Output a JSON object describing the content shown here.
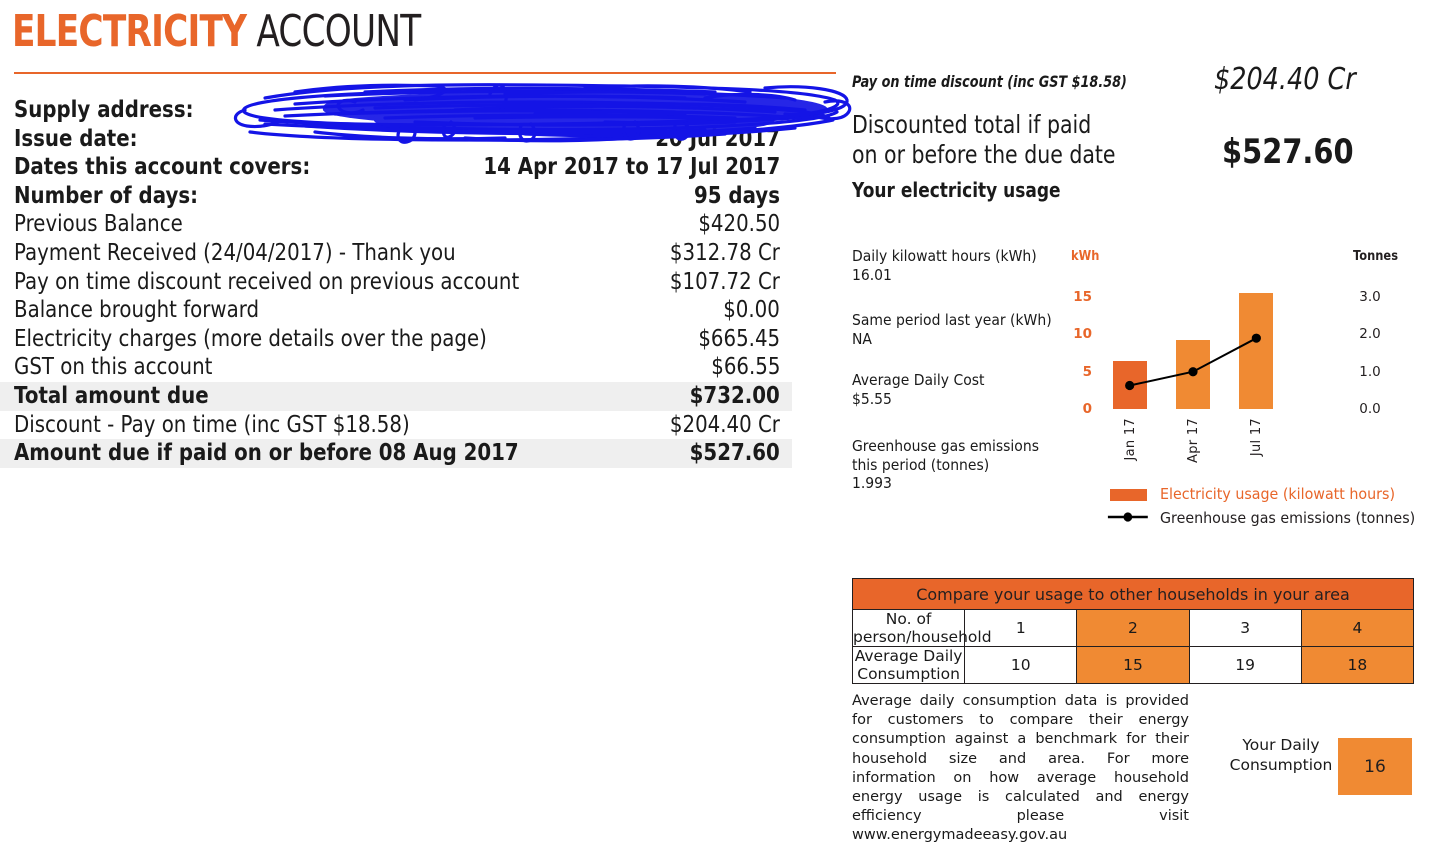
{
  "title": {
    "highlight": "ELECTRICITY",
    "rest": " ACCOUNT"
  },
  "summary": {
    "rows": [
      {
        "label": "Supply address:",
        "value": "",
        "bold": true,
        "shaded": false
      },
      {
        "label": "Issue date:",
        "value": "20 Jul 2017",
        "bold": true,
        "shaded": false
      },
      {
        "label": "Dates this account covers:",
        "value": "14 Apr 2017 to 17 Jul 2017",
        "bold": true,
        "shaded": false
      },
      {
        "label": "Number of days:",
        "value": "95 days",
        "bold": true,
        "shaded": false
      },
      {
        "label": "Previous Balance",
        "value": "$420.50",
        "bold": false,
        "shaded": false
      },
      {
        "label": "Payment Received (24/04/2017) - Thank you",
        "value": "$312.78 Cr",
        "bold": false,
        "shaded": false
      },
      {
        "label": "Pay on time discount received on previous account",
        "value": "$107.72 Cr",
        "bold": false,
        "shaded": false
      },
      {
        "label": "Balance brought forward",
        "value": "$0.00",
        "bold": false,
        "shaded": false
      },
      {
        "label": "Electricity charges (more details over the page)",
        "value": "$665.45",
        "bold": false,
        "shaded": false
      },
      {
        "label": "GST on this account",
        "value": "$66.55",
        "bold": false,
        "shaded": false
      },
      {
        "label": "Total amount due",
        "value": "$732.00",
        "bold": true,
        "shaded": true
      },
      {
        "label": "Discount - Pay on time (inc GST $18.58)",
        "value": "$204.40 Cr",
        "bold": false,
        "shaded": false
      },
      {
        "label": "Amount due if paid on or before 08 Aug 2017",
        "value": "$527.60",
        "bold": true,
        "shaded": true
      }
    ]
  },
  "redaction": {
    "color": "#1414E6",
    "description": "blue-scribble-redaction-over-supply-address"
  },
  "right_header": {
    "discount_note": "Pay on time discount (inc GST $18.58)",
    "discount_amount": "$204.40 Cr",
    "discounted_total_label_line1": "Discounted total if paid",
    "discounted_total_label_line2": "on or before the due date",
    "discounted_total_amount": "$527.60",
    "usage_heading": "Your electricity usage"
  },
  "usage_stats": [
    {
      "label": "Daily kilowatt hours (kWh)",
      "value": "16.01"
    },
    {
      "label": "Same period last year (kWh)",
      "value": "NA"
    },
    {
      "label": "Average Daily Cost",
      "value": "$5.55"
    },
    {
      "label": "Greenhouse gas emissions",
      "label2": "this period (tonnes)",
      "value": "1.993"
    }
  ],
  "chart_data": {
    "type": "bar",
    "title": "Your electricity usage",
    "categories": [
      "Jan 17",
      "Apr 17",
      "Jul 17"
    ],
    "series": [
      {
        "name": "Electricity usage (kilowatt hours)",
        "type": "bar",
        "axis": "left",
        "values": [
          6.4,
          9.2,
          15.6
        ],
        "colors": [
          "#E8662A",
          "#F08A33",
          "#F08A33"
        ]
      },
      {
        "name": "Greenhouse gas emissions (tonnes)",
        "type": "line",
        "axis": "right",
        "values": [
          0.63,
          1.0,
          1.9
        ],
        "color": "#000000"
      }
    ],
    "ylabel": "kWh",
    "y2label": "Tonnes",
    "yticks": [
      "15",
      "10",
      "5",
      "0"
    ],
    "ylim": [
      0,
      16.5
    ],
    "y2ticks": [
      "3.0",
      "2.0",
      "1.0",
      "0.0"
    ],
    "y2lim": [
      0,
      3.3
    ],
    "grid": false,
    "legend_position": "bottom"
  },
  "compare_table": {
    "title": "Compare your usage to other households in your area",
    "rows": [
      {
        "label": "No. of person/household",
        "values": [
          "1",
          "2",
          "3",
          "4"
        ]
      },
      {
        "label": "Average Daily Consumption",
        "values": [
          "10",
          "15",
          "19",
          "18"
        ]
      }
    ],
    "highlighted_columns": [
      1,
      3
    ],
    "highlight_color": "#F08A33",
    "header_color": "#E8662A"
  },
  "footer": {
    "note": "Average daily consumption data is provided for customers to compare their energy consumption against a benchmark for their household size and area. For more information on how average household energy usage is calculated and energy efficiency please visit www.energymadeeasy.gov.au",
    "your_consumption_label": "Your Daily Consumption",
    "your_consumption_value": "16"
  }
}
